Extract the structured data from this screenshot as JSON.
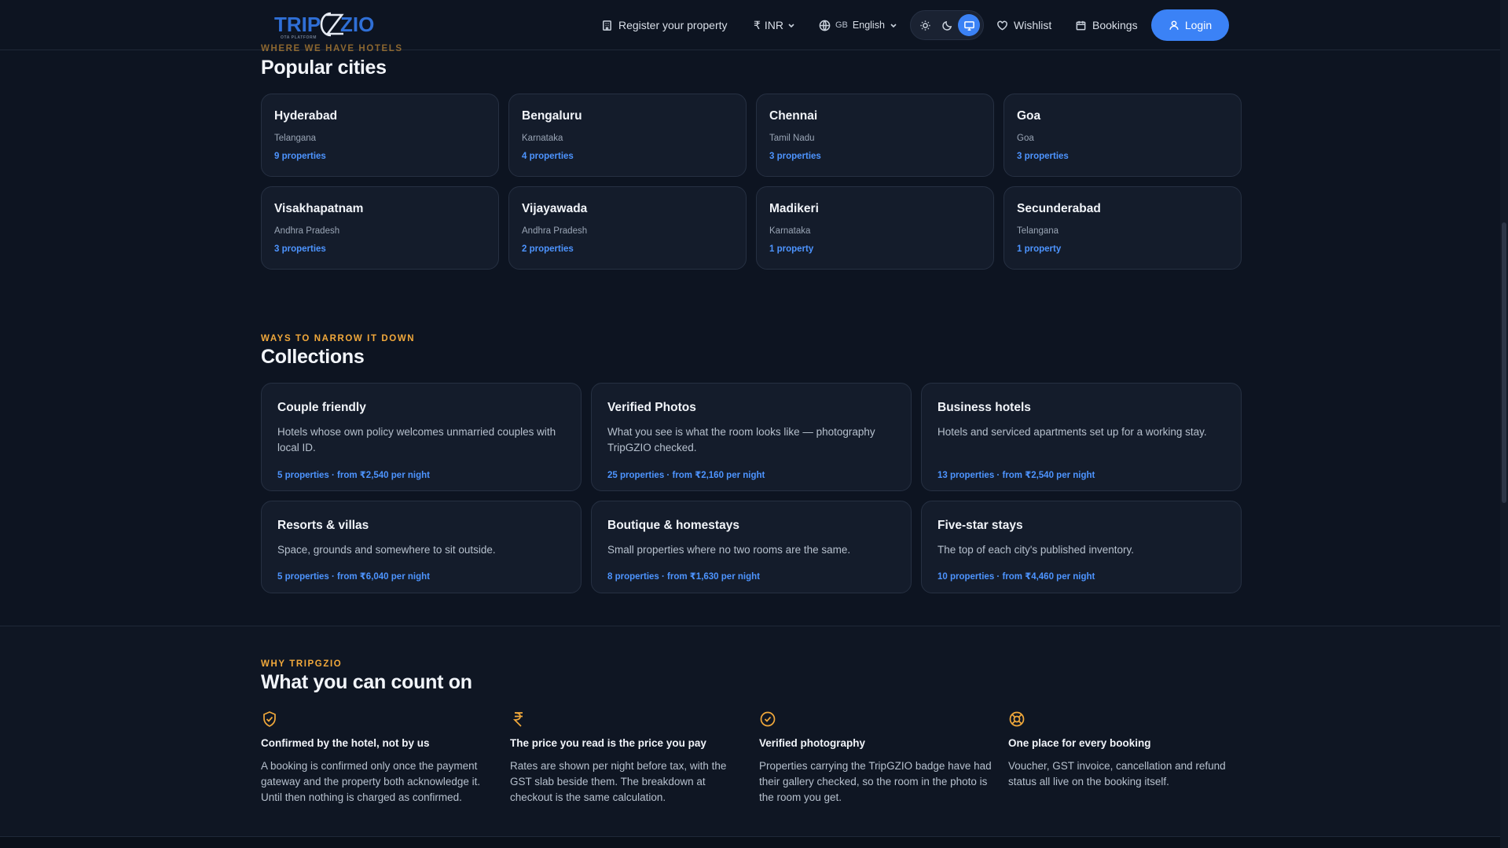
{
  "header": {
    "logo": {
      "brand_part1": "TRIP",
      "brand_part2": "ZIO",
      "tagline": "OTA PLATFORM"
    },
    "register_label": "Register your property",
    "currency_symbol": "₹",
    "currency_label": "INR",
    "language_flag": "GB",
    "language_label": "English",
    "wishlist_label": "Wishlist",
    "bookings_label": "Bookings",
    "login_label": "Login",
    "theme_modes": [
      "light",
      "dark",
      "system"
    ],
    "active_theme": "system"
  },
  "cities_section": {
    "eyebrow": "WHERE WE HAVE HOTELS",
    "title": "Popular cities",
    "cities": [
      {
        "name": "Hyderabad",
        "state": "Telangana",
        "count": "9 properties"
      },
      {
        "name": "Bengaluru",
        "state": "Karnataka",
        "count": "4 properties"
      },
      {
        "name": "Chennai",
        "state": "Tamil Nadu",
        "count": "3 properties"
      },
      {
        "name": "Goa",
        "state": "Goa",
        "count": "3 properties"
      },
      {
        "name": "Visakhapatnam",
        "state": "Andhra Pradesh",
        "count": "3 properties"
      },
      {
        "name": "Vijayawada",
        "state": "Andhra Pradesh",
        "count": "2 properties"
      },
      {
        "name": "Madikeri",
        "state": "Karnataka",
        "count": "1 property"
      },
      {
        "name": "Secunderabad",
        "state": "Telangana",
        "count": "1 property"
      }
    ]
  },
  "collections_section": {
    "eyebrow": "WAYS TO NARROW IT DOWN",
    "title": "Collections",
    "items": [
      {
        "title": "Couple friendly",
        "desc": "Hotels whose own policy welcomes unmarried couples with local ID.",
        "meta": "5 properties · from ₹2,540 per night"
      },
      {
        "title": "Verified Photos",
        "desc": "What you see is what the room looks like — photography TripGZIO checked.",
        "meta": "25 properties · from ₹2,160 per night"
      },
      {
        "title": "Business hotels",
        "desc": "Hotels and serviced apartments set up for a working stay.",
        "meta": "13 properties · from ₹2,540 per night"
      },
      {
        "title": "Resorts & villas",
        "desc": "Space, grounds and somewhere to sit outside.",
        "meta": "5 properties · from ₹6,040 per night"
      },
      {
        "title": "Boutique & homestays",
        "desc": "Small properties where no two rooms are the same.",
        "meta": "8 properties · from ₹1,630 per night"
      },
      {
        "title": "Five-star stays",
        "desc": "The top of each city's published inventory.",
        "meta": "10 properties · from ₹4,460 per night"
      }
    ]
  },
  "why_section": {
    "eyebrow": "WHY TRIPGZIO",
    "title": "What you can count on",
    "features": [
      {
        "icon": "shield-check-icon",
        "title": "Confirmed by the hotel, not by us",
        "desc": "A booking is confirmed only once the payment gateway and the property both acknowledge it. Until then nothing is charged as confirmed."
      },
      {
        "icon": "rupee-icon",
        "title": "The price you read is the price you pay",
        "desc": "Rates are shown per night before tax, with the GST slab beside them. The breakdown at checkout is the same calculation."
      },
      {
        "icon": "badge-check-icon",
        "title": "Verified photography",
        "desc": "Properties carrying the TripGZIO badge have had their gallery checked, so the room in the photo is the room you get."
      },
      {
        "icon": "lifebuoy-icon",
        "title": "One place for every booking",
        "desc": "Voucher, GST invoice, cancellation and refund status all live on the booking itself."
      }
    ]
  },
  "colors": {
    "background": "#0d1421",
    "card": "#141c2b",
    "accent_blue": "#3b82f6",
    "link_blue": "#4d94ff",
    "eyebrow_orange": "#f2a93b"
  }
}
